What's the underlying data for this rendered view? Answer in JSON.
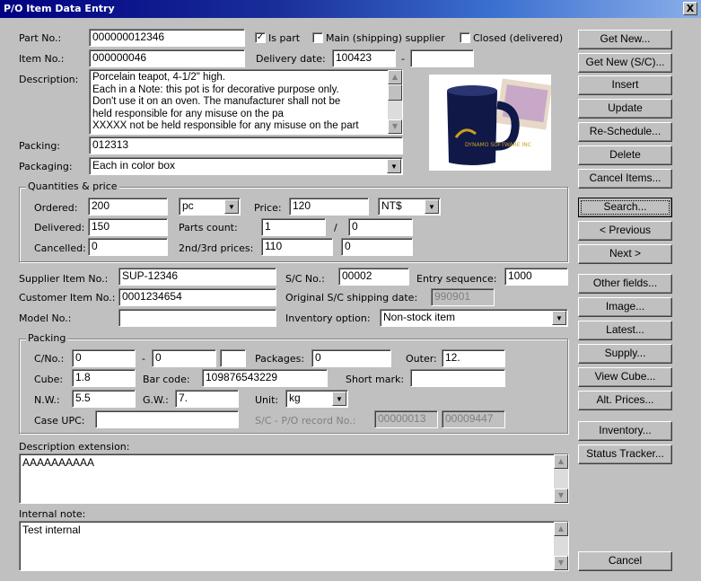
{
  "window": {
    "title": "P/O Item Data Entry",
    "close_label": "X"
  },
  "labels": {
    "part_no": "Part No.:",
    "item_no": "Item No.:",
    "description": "Description:",
    "packing": "Packing:",
    "packaging": "Packaging:",
    "delivery_date": "Delivery date:",
    "date_sep": "-",
    "is_part": "Is part",
    "main_supplier": "Main (shipping) supplier",
    "closed": "Closed (delivered)"
  },
  "fields": {
    "part_no": "000000012346",
    "item_no": "000000046",
    "delivery_date": "100423",
    "delivery_date_end": "",
    "description": "Porcelain teapot, 4-1/2\" high.\nEach in a Note: this pot is for decorative purpose only.\nDon't use it on an oven. The manufacturer shall not be\nheld responsible for any misuse on the pa\nXXXXX not be held responsible for any misuse on the part",
    "packing": "012313",
    "packaging": "Each in color box"
  },
  "checks": {
    "is_part": "✓",
    "main_supplier": "",
    "closed": ""
  },
  "quantities": {
    "title": "Quantities & price",
    "ordered_label": "Ordered:",
    "ordered": "200",
    "unit": "pc",
    "price_label": "Price:",
    "price": "120",
    "currency": "NT$",
    "delivered_label": "Delivered:",
    "delivered": "150",
    "parts_count_label": "Parts count:",
    "parts_count": "1",
    "slash": "/",
    "parts_count_of": "0",
    "cancelled_label": "Cancelled:",
    "cancelled": "0",
    "prices23_label": "2nd/3rd prices:",
    "price2": "110",
    "price3": "0"
  },
  "supplier": {
    "supplier_item_label": "Supplier Item No.:",
    "supplier_item": "SUP-12346",
    "sc_no_label": "S/C No.:",
    "sc_no": "00002",
    "entry_seq_label": "Entry sequence:",
    "entry_seq": "1000",
    "customer_item_label": "Customer Item No.:",
    "customer_item": "0001234654",
    "orig_sc_date_label": "Original S/C shipping date:",
    "orig_sc_date": "990901",
    "model_label": "Model No.:",
    "model": "",
    "inventory_label": "Inventory option:",
    "inventory": "Non-stock item"
  },
  "packing_group": {
    "title": "Packing",
    "cno_label": "C/No.:",
    "cno_from": "0",
    "cno_sep": "-",
    "cno_to": "0",
    "cno_suffix": "",
    "packages_label": "Packages:",
    "packages": "0",
    "outer_label": "Outer:",
    "outer": "12.",
    "cube_label": "Cube:",
    "cube": "1.8",
    "barcode_label": "Bar code:",
    "barcode": "109876543229",
    "shortmark_label": "Short mark:",
    "shortmark": "",
    "nw_label": "N.W.:",
    "nw": "5.5",
    "gw_label": "G.W.:",
    "gw": "7.",
    "unit_label": "Unit:",
    "unit": "kg",
    "upc_label": "Case UPC:",
    "upc": "",
    "record_label": "S/C - P/O record No.:",
    "record1": "00000013",
    "record2": "00009447"
  },
  "desc_ext": {
    "label": "Description extension:",
    "value": "AAAAAAAAAA"
  },
  "internal_note": {
    "label": "Internal note:",
    "value": "Test internal"
  },
  "buttons": {
    "get_new": "Get New...",
    "get_new_sc": "Get New (S/C)...",
    "insert": "Insert",
    "update": "Update",
    "reschedule": "Re-Schedule...",
    "delete": "Delete",
    "cancel_items": "Cancel Items...",
    "search": "Search...",
    "previous": "< Previous",
    "next": "Next >",
    "other_fields": "Other fields...",
    "image": "Image...",
    "latest": "Latest...",
    "supply": "Supply...",
    "view_cube": "View Cube...",
    "alt_prices": "Alt. Prices...",
    "inventory": "Inventory...",
    "status_tracker": "Status Tracker...",
    "cancel": "Cancel"
  },
  "image": {
    "mug_text": "DYNAMO SOFTWARE INC",
    "alt": "mug-photo"
  }
}
